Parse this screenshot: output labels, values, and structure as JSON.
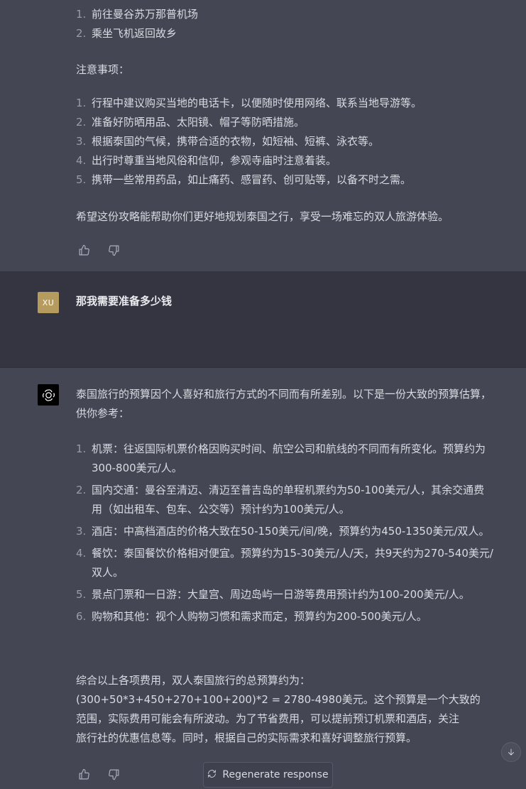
{
  "prev_answer": {
    "steps": [
      {
        "num": "1.",
        "text": "前往曼谷苏万那普机场"
      },
      {
        "num": "2.",
        "text": "乘坐飞机返回故乡"
      }
    ],
    "notes_title": "注意事项：",
    "notes": [
      {
        "num": "1.",
        "text": "行程中建议购买当地的电话卡，以便随时使用网络、联系当地导游等。"
      },
      {
        "num": "2.",
        "text": "准备好防晒用品、太阳镜、帽子等防晒措施。"
      },
      {
        "num": "3.",
        "text": "根据泰国的气候，携带合适的衣物，如短袖、短裤、泳衣等。"
      },
      {
        "num": "4.",
        "text": "出行时尊重当地风俗和信仰，参观寺庙时注意着装。"
      },
      {
        "num": "5.",
        "text": "携带一些常用药品，如止痛药、感冒药、创可贴等，以备不时之需。"
      }
    ],
    "closing": "希望这份攻略能帮助你们更好地规划泰国之行，享受一场难忘的双人旅游体验。"
  },
  "user": {
    "avatar_text": "XU",
    "message": "那我需要准备多少钱"
  },
  "answer": {
    "intro": "泰国旅行的预算因个人喜好和旅行方式的不同而有所差别。以下是一份大致的预算估算，供你参考：",
    "items": [
      {
        "num": "1.",
        "text": "机票：往返国际机票价格因购买时间、航空公司和航线的不同而有所变化。预算约为300-800美元/人。"
      },
      {
        "num": "2.",
        "text": "国内交通：曼谷至清迈、清迈至普吉岛的单程机票约为50-100美元/人，其余交通费用（如出租车、包车、公交等）预计约为100美元/人。"
      },
      {
        "num": "3.",
        "text": "酒店：中高档酒店的价格大致在50-150美元/间/晚，预算约为450-1350美元/双人。"
      },
      {
        "num": "4.",
        "text": "餐饮：泰国餐饮价格相对便宜。预算约为15-30美元/人/天，共9天约为270-540美元/双人。"
      },
      {
        "num": "5.",
        "text": "景点门票和一日游：大皇宫、周边岛屿一日游等费用预计约为100-200美元/人。"
      },
      {
        "num": "6.",
        "text": "购物和其他：视个人购物习惯和需求而定，预算约为200-500美元/人。"
      }
    ],
    "summary_lines": [
      "综合以上各项费用，双人泰国旅行的总预算约为：",
      "(300+50*3+450+270+100+200)*2 = 2780-4980美元。这个预算是一个大致的",
      "范围，实际费用可能会有所波动。为了节省费用，可以提前预订机票和酒店，关注",
      "旅行社的优惠信息等。同时，根据自己的实际需求和喜好调整旅行预算。"
    ]
  },
  "controls": {
    "regenerate_label": "Regenerate response"
  },
  "icons": {
    "thumbs_up": "thumbs-up-icon",
    "thumbs_down": "thumbs-down-icon",
    "regenerate": "refresh-icon",
    "scroll_down": "arrow-down-icon",
    "assistant_logo": "openai-logo-icon"
  },
  "colors": {
    "assistant_bg": "#444654",
    "user_bg": "#343541",
    "user_avatar": "#b69b5e",
    "assistant_avatar": "#000000"
  }
}
